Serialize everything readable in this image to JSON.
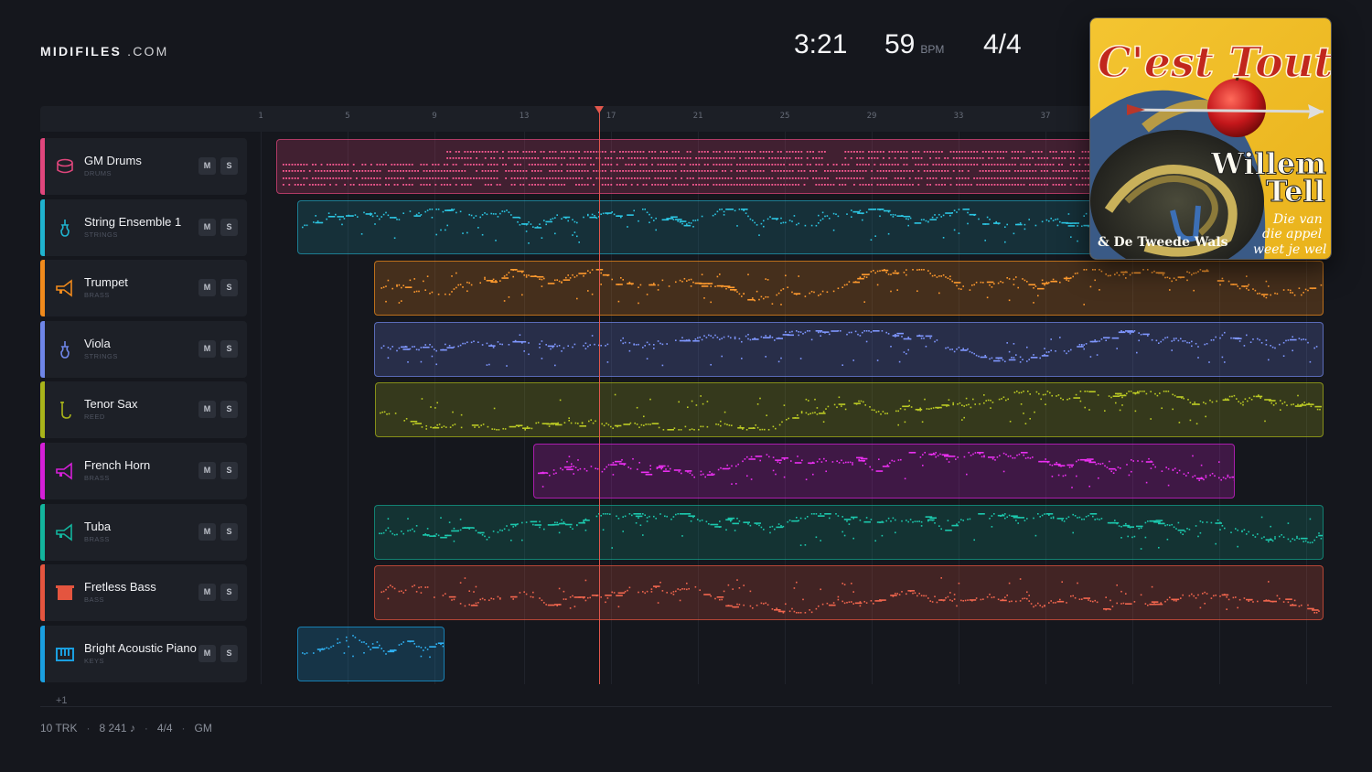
{
  "brand": {
    "bold": "MIDIFILES",
    "rest": " .COM"
  },
  "transport": {
    "time": "3:21",
    "bpm": "59",
    "bpm_unit": "BPM",
    "signature": "4/4"
  },
  "album": {
    "title": "C'est Tout",
    "artist_line1": "Willem",
    "artist_line2": "Tell",
    "credit": "& De Tweede Wals",
    "tagline1": "Die van",
    "tagline2": "die appel",
    "tagline3": "weet je wel"
  },
  "ruler": {
    "bars": [
      "1",
      "5",
      "9",
      "13",
      "17",
      "21",
      "25",
      "29",
      "33",
      "37"
    ]
  },
  "tracks": [
    {
      "name": "GM Drums",
      "category": "DRUMS",
      "color": "#e0467c",
      "icon": "drum-icon",
      "mute": "M",
      "solo": "S"
    },
    {
      "name": "String Ensemble 1",
      "category": "STRINGS",
      "color": "#1fb3cf",
      "icon": "violin-icon",
      "mute": "M",
      "solo": "S"
    },
    {
      "name": "Trumpet",
      "category": "BRASS",
      "color": "#f08a1c",
      "icon": "horn-icon",
      "mute": "M",
      "solo": "S"
    },
    {
      "name": "Viola",
      "category": "STRINGS",
      "color": "#6f86e8",
      "icon": "violin-icon",
      "mute": "M",
      "solo": "S"
    },
    {
      "name": "Tenor Sax",
      "category": "REED",
      "color": "#a8b41a",
      "icon": "sax-icon",
      "mute": "M",
      "solo": "S"
    },
    {
      "name": "French Horn",
      "category": "BRASS",
      "color": "#d51fd8",
      "icon": "horn-icon",
      "mute": "M",
      "solo": "S"
    },
    {
      "name": "Tuba",
      "category": "BRASS",
      "color": "#13b59d",
      "icon": "horn-icon",
      "mute": "M",
      "solo": "S"
    },
    {
      "name": "Fretless Bass",
      "category": "BASS",
      "color": "#e4553f",
      "icon": "bass-icon",
      "mute": "M",
      "solo": "S"
    },
    {
      "name": "Bright Acoustic Piano",
      "category": "KEYS",
      "color": "#1a9fe0",
      "icon": "keyboard-icon",
      "mute": "M",
      "solo": "S"
    }
  ],
  "more_tracks": "+1",
  "footer": {
    "tracks": "10 TRK",
    "notes": "8 241 ♪",
    "signature": "4/4",
    "standard": "GM"
  },
  "colors": {
    "playhead": "#e2574c",
    "background": "#15171d"
  }
}
